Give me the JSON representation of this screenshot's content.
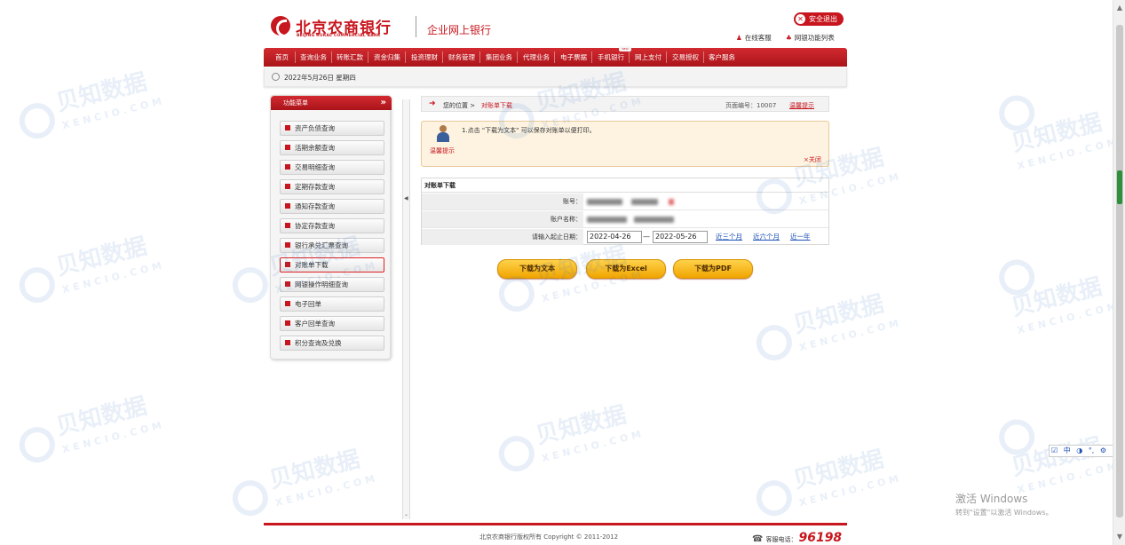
{
  "header": {
    "bank_name": "北京农商银行",
    "bank_name_en": "BEIJING RURAL COMMERCIAL BANK",
    "portal_name": "企业网上银行",
    "logout_label": "安全退出",
    "online_service": "在线客服",
    "function_list": "网银功能列表"
  },
  "nav": {
    "items": [
      "首页",
      "查询业务",
      "转账汇款",
      "资金归集",
      "投资理财",
      "财务管理",
      "集团业务",
      "代理业务",
      "电子票据",
      "手机银行",
      "网上支付",
      "交易授权",
      "客户服务"
    ],
    "badge": "NEW"
  },
  "datebar": {
    "date": "2022年5月26日 星期四"
  },
  "sidebar": {
    "title": "功能菜单",
    "items": [
      {
        "label": "资产负债查询"
      },
      {
        "label": "活期余额查询"
      },
      {
        "label": "交易明细查询"
      },
      {
        "label": "定期存款查询"
      },
      {
        "label": "通知存款查询"
      },
      {
        "label": "协定存款查询"
      },
      {
        "label": "银行承兑汇票查询"
      },
      {
        "label": "对账单下载"
      },
      {
        "label": "网银操作明细查询"
      },
      {
        "label": "电子回单"
      },
      {
        "label": "客户回单查询"
      },
      {
        "label": "积分查询及兑换"
      }
    ],
    "active_index": 7
  },
  "breadcrumb": {
    "location_label": "您的位置 >",
    "current": "对账单下载",
    "page_number": "页面编号：10007",
    "tip_link": "温馨提示"
  },
  "notice": {
    "tag": "温馨提示",
    "message": "1.点击 \"下载为文本\" 可以保存对账单以便打印。",
    "close": "×关闭"
  },
  "form": {
    "title": "对账单下载",
    "account_label": "账号：",
    "account_name_label": "账户名称：",
    "date_label": "请输入起止日期：",
    "start_date": "2022-04-26",
    "separator": "—",
    "end_date": "2022-05-26",
    "quick_ranges": [
      "近三个月",
      "近六个月",
      "近一年"
    ]
  },
  "buttons": {
    "text": "下载为文本",
    "excel": "下载为Excel",
    "pdf": "下载为PDF"
  },
  "footer": {
    "copyright": "北京农商银行版权所有 Copyright © 2011-2012",
    "hotline_label": "客服电话：",
    "hotline_number": "96198"
  },
  "watermark": {
    "cn": "贝知数据",
    "en": "XENCIO.COM"
  },
  "ime": [
    "中",
    "◑",
    "°,",
    "⚙"
  ],
  "os_notice": {
    "line1": "激活 Windows",
    "line2": "转到\"设置\"以激活 Windows。"
  }
}
